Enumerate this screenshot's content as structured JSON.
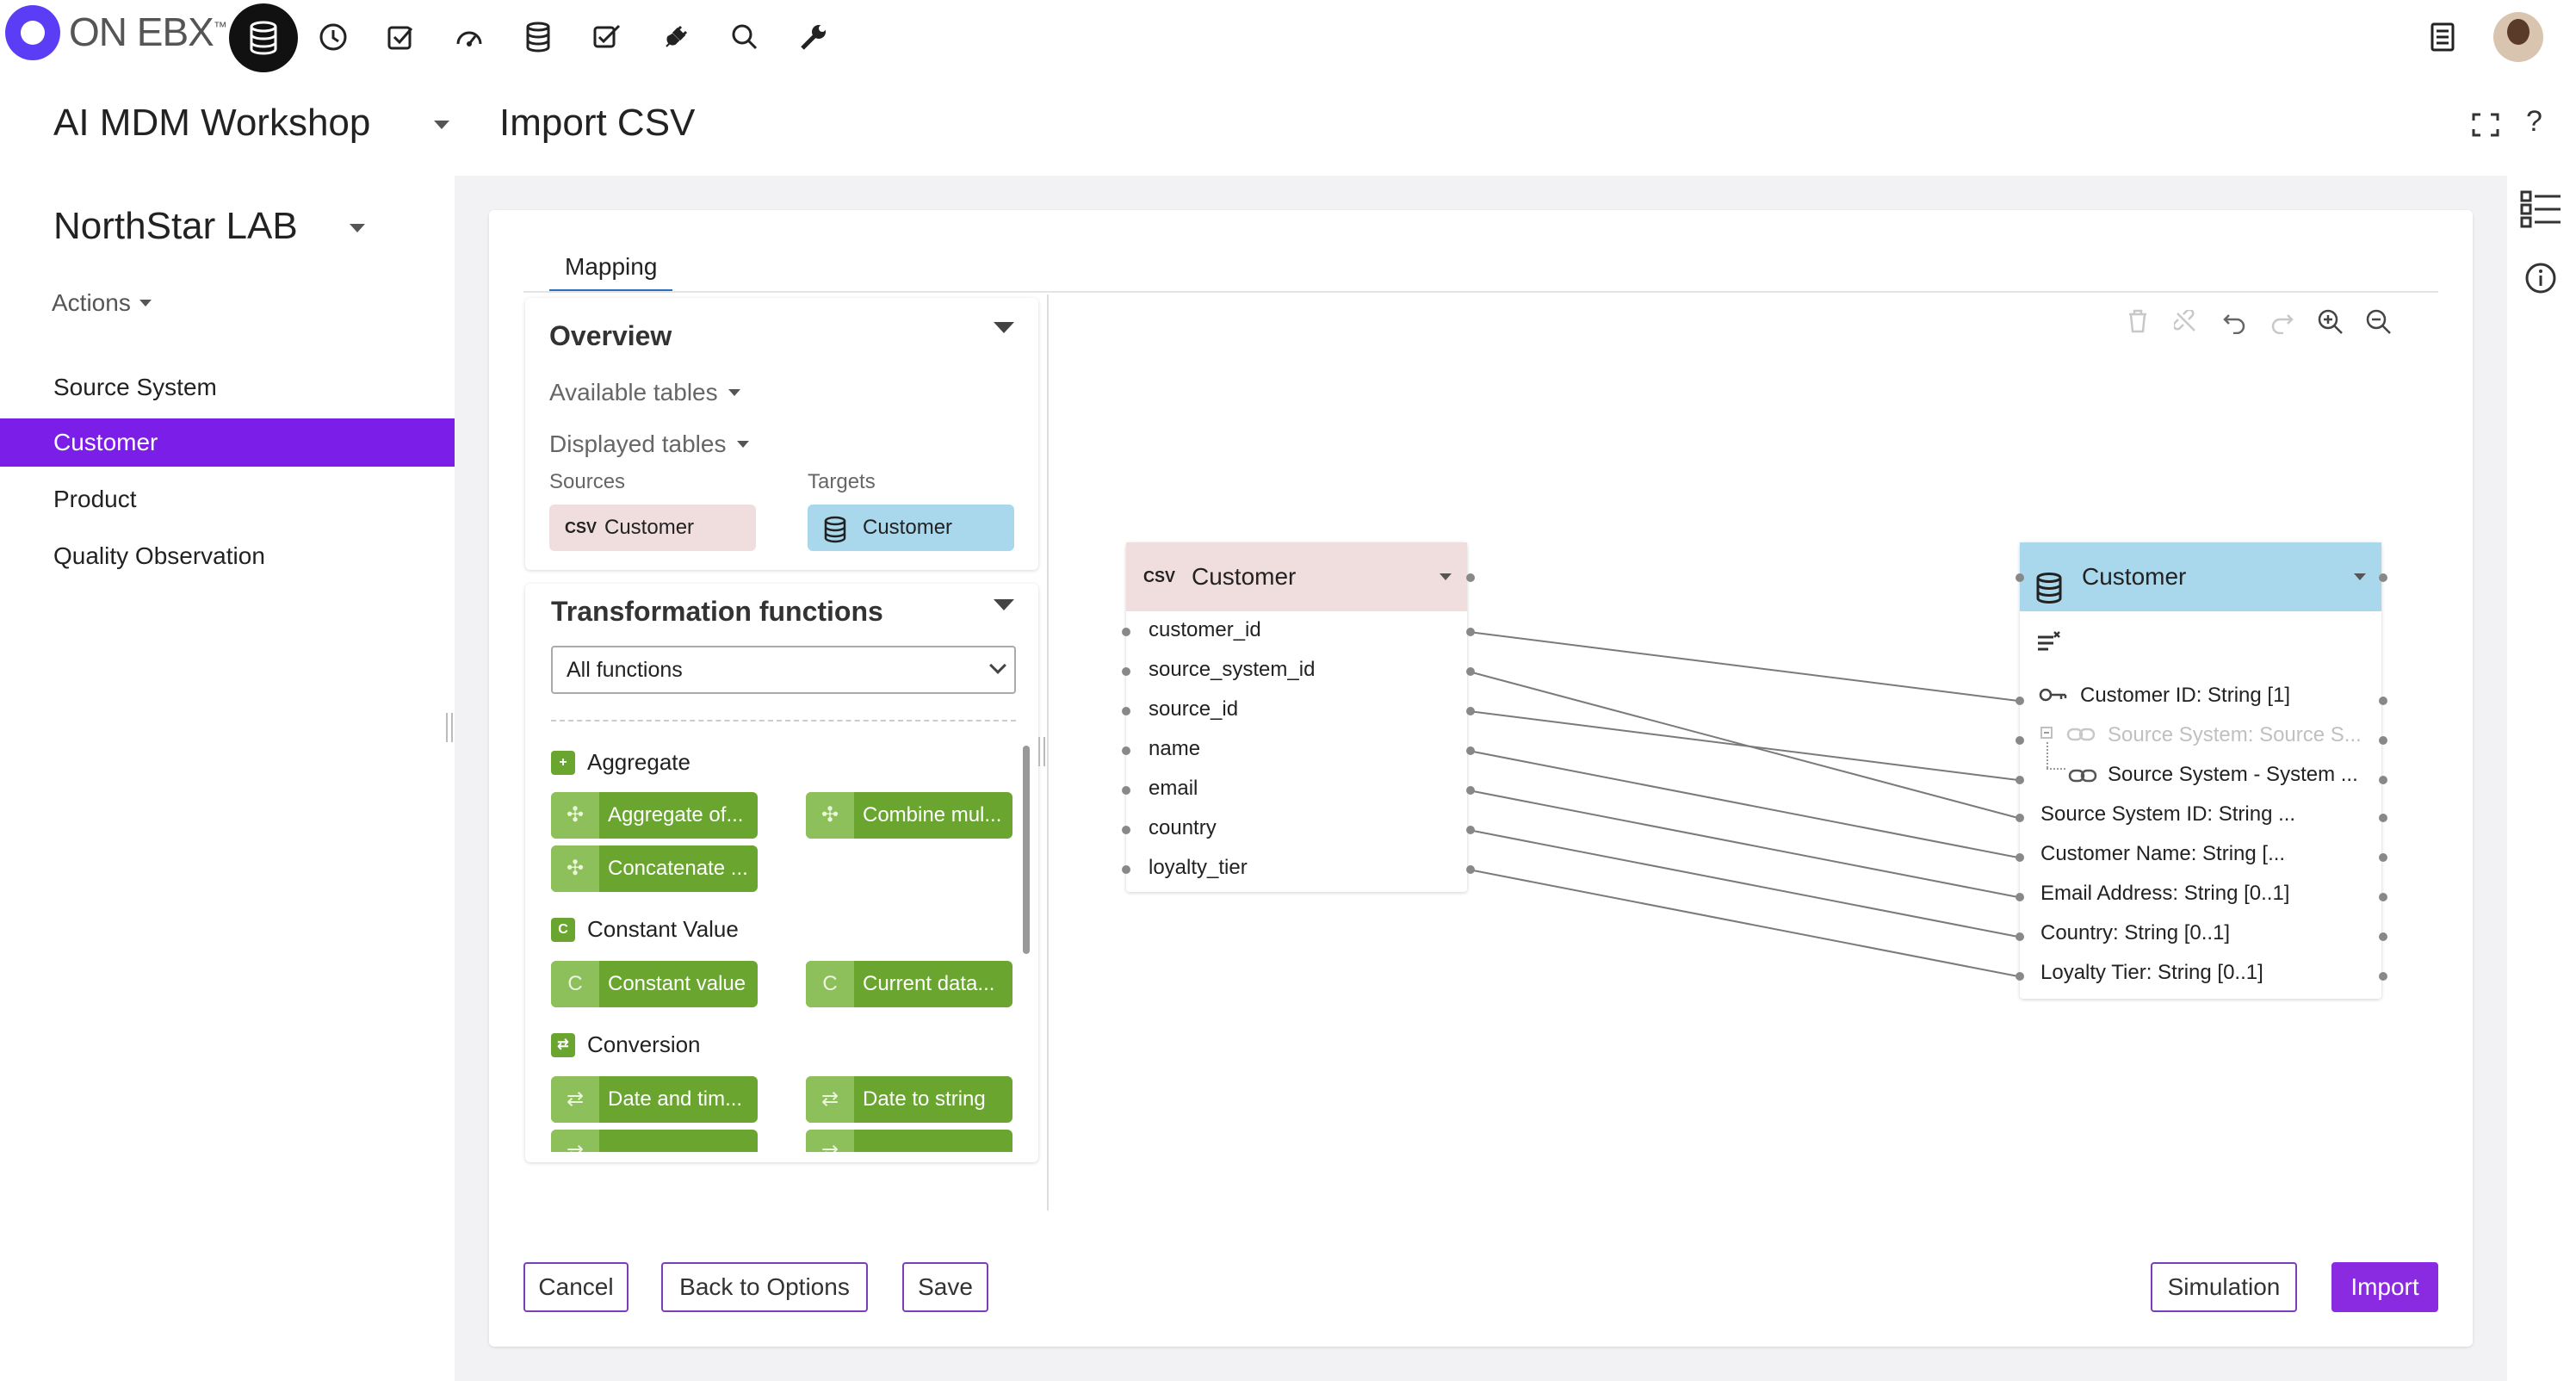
{
  "app": {
    "logo_text": "ON EBX",
    "logo_tm": "™",
    "top_icons": [
      "database-icon",
      "clock-icon",
      "checkbox-icon",
      "dashboard-icon",
      "data-stack-icon",
      "checklist-icon",
      "plug-icon",
      "search-icon",
      "wrench-icon"
    ],
    "right_icons": [
      "task-list-icon",
      "avatar"
    ]
  },
  "workspace": {
    "title": "AI MDM Workshop",
    "page_title": "Import CSV",
    "fullscreen_icon": "fullscreen-icon",
    "help_label": "?"
  },
  "sidebar": {
    "dataset_title": "NorthStar LAB",
    "actions_label": "Actions",
    "items": [
      {
        "label": "Source System",
        "active": false
      },
      {
        "label": "Customer",
        "active": true
      },
      {
        "label": "Product",
        "active": false
      },
      {
        "label": "Quality Observation",
        "active": false
      }
    ]
  },
  "mapping": {
    "tab_label": "Mapping",
    "overview": {
      "title": "Overview",
      "available_tables": "Available tables",
      "displayed_tables": "Displayed tables",
      "sources_label": "Sources",
      "targets_label": "Targets",
      "source_chip": "Customer",
      "source_chip_icon": "CSV",
      "target_chip": "Customer"
    },
    "transformation": {
      "title": "Transformation functions",
      "select_value": "All functions",
      "categories": [
        {
          "name": "Aggregate",
          "icon": "+",
          "functions": [
            "Aggregate of...",
            "Combine mul...",
            "Concatenate ..."
          ]
        },
        {
          "name": "Constant Value",
          "icon": "C",
          "functions": [
            "Constant value",
            "Current data..."
          ]
        },
        {
          "name": "Conversion",
          "icon": "⇄",
          "functions": [
            "Date and tim...",
            "Date to string"
          ]
        }
      ]
    },
    "toolbar": [
      "trash-icon",
      "unlink-icon",
      "undo-icon",
      "redo-icon",
      "zoom-in-icon",
      "zoom-out-icon"
    ],
    "source_table": {
      "title": "Customer",
      "icon": "CSV",
      "fields": [
        "customer_id",
        "source_system_id",
        "source_id",
        "name",
        "email",
        "country",
        "loyalty_tier"
      ]
    },
    "target_table": {
      "title": "Customer",
      "fields": [
        {
          "label": "Customer ID: String [1]",
          "icon": "key-icon",
          "faded": false
        },
        {
          "label": "Source System: Source S...",
          "icon": "link-icon",
          "faded": true
        },
        {
          "label": "Source System - System ...",
          "icon": "link-icon",
          "faded": false
        },
        {
          "label": "Source System ID: String ...",
          "icon": "",
          "faded": false
        },
        {
          "label": "Customer Name: String [...",
          "icon": "",
          "faded": false
        },
        {
          "label": "Email Address: String [0..1]",
          "icon": "",
          "faded": false
        },
        {
          "label": "Country: String [0..1]",
          "icon": "",
          "faded": false
        },
        {
          "label": "Loyalty Tier: String [0..1]",
          "icon": "",
          "faded": false
        }
      ]
    }
  },
  "buttons": {
    "cancel": "Cancel",
    "back": "Back to Options",
    "save": "Save",
    "simulation": "Simulation",
    "import": "Import"
  },
  "colors": {
    "accent": "#7b1fe8",
    "primary_button": "#8a2be2",
    "function_green": "#6aa52f",
    "source_header": "#f0dede",
    "target_header": "#a9d8ec"
  }
}
